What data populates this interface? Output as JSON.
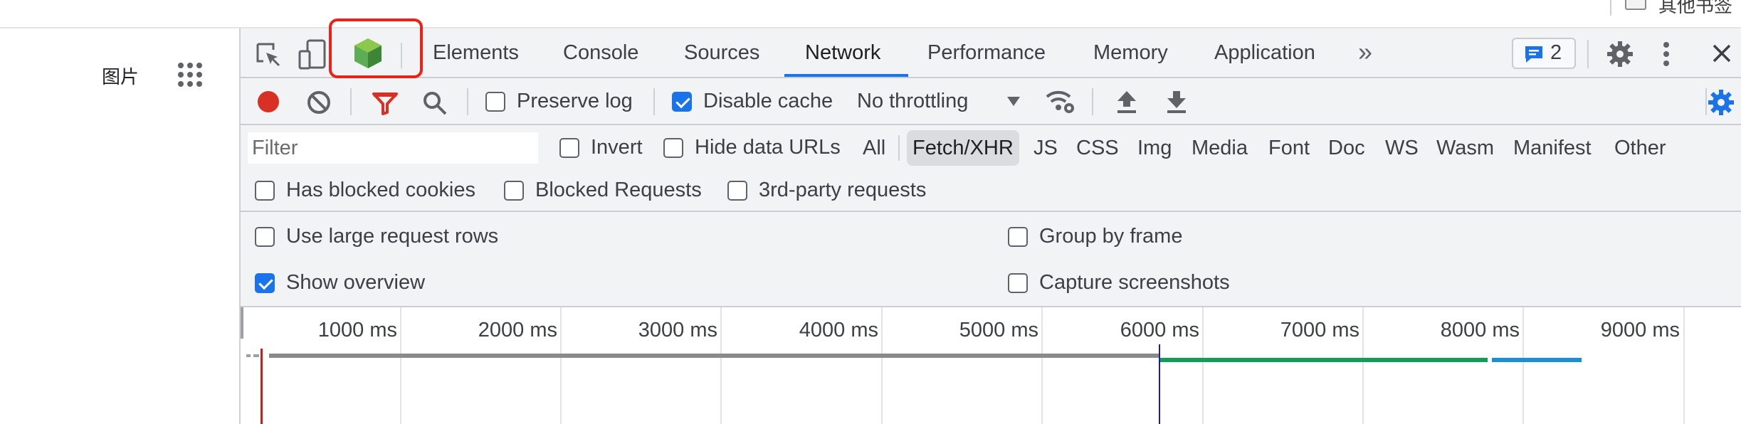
{
  "browser": {
    "bookmark_label": "其他书签",
    "page_text": "图片"
  },
  "devtools": {
    "tabs": [
      "Elements",
      "Console",
      "Sources",
      "Network",
      "Performance",
      "Memory",
      "Application"
    ],
    "active_tab": "Network",
    "overflow_icon": "»",
    "messages_count": "2",
    "toolbar": {
      "preserve_log": "Preserve log",
      "disable_cache": "Disable cache",
      "throttling": "No throttling"
    },
    "filter": {
      "placeholder": "Filter",
      "invert": "Invert",
      "hide_data_urls": "Hide data URLs",
      "types": [
        "All",
        "Fetch/XHR",
        "JS",
        "CSS",
        "Img",
        "Media",
        "Font",
        "Doc",
        "WS",
        "Wasm",
        "Manifest",
        "Other"
      ],
      "selected_type": "Fetch/XHR",
      "has_blocked_cookies": "Has blocked cookies",
      "blocked_requests": "Blocked Requests",
      "third_party": "3rd-party requests"
    },
    "settings": {
      "large_rows": "Use large request rows",
      "group_by_frame": "Group by frame",
      "show_overview": "Show overview",
      "capture_screenshots": "Capture screenshots"
    },
    "states": {
      "preserve_log": false,
      "disable_cache": true,
      "invert": false,
      "hide_data_urls": false,
      "has_blocked_cookies": false,
      "blocked_requests": false,
      "third_party": false,
      "large_rows": false,
      "group_by_frame": false,
      "show_overview": true,
      "capture_screenshots": false
    },
    "overview": {
      "ticks": [
        "1000 ms",
        "2000 ms",
        "3000 ms",
        "4000 ms",
        "5000 ms",
        "6000 ms",
        "7000 ms",
        "8000 ms",
        "9000 ms"
      ]
    },
    "colors": {
      "accent": "#1a73e8",
      "record": "#d93025",
      "highlight_box": "#e8241a",
      "node_icon": "#5cad53",
      "overview_green": "#0f9d58",
      "overview_blue": "#1a8fd6"
    },
    "icons": [
      "inspect-icon",
      "device-toolbar-icon",
      "node-icon",
      "overflow-icon",
      "message-icon",
      "gear-icon",
      "kebab-icon",
      "close-icon",
      "record-icon",
      "clear-icon",
      "filter-icon",
      "search-icon",
      "network-conditions-icon",
      "import-icon",
      "export-icon",
      "settings-gear-icon"
    ]
  }
}
